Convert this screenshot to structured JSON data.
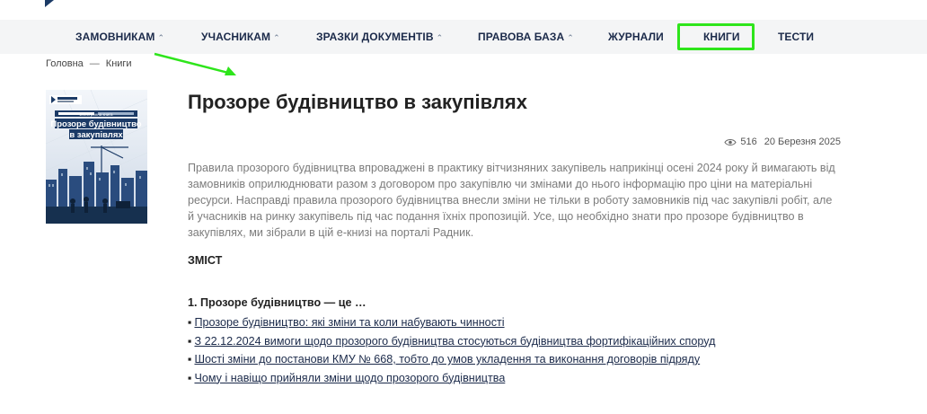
{
  "nav": {
    "items": [
      {
        "label": "ЗАМОВНИКАМ",
        "caret": "^"
      },
      {
        "label": "УЧАСНИКАМ",
        "caret": "^"
      },
      {
        "label": "ЗРАЗКИ ДОКУМЕНТІВ",
        "caret": "^"
      },
      {
        "label": "ПРАВОВА БАЗА",
        "caret": "^"
      },
      {
        "label": "ЖУРНАЛИ",
        "caret": ""
      },
      {
        "label": "КНИГИ",
        "caret": ""
      },
      {
        "label": "ТЕСТИ",
        "caret": ""
      }
    ],
    "highlight_color": "#2ee51b"
  },
  "breadcrumb": {
    "home": "Головна",
    "separator": "—",
    "current": "Книги"
  },
  "cover": {
    "brand": "РАДНИК",
    "kicker": "Електронна книга",
    "title_line1": "Прозоре будівництво",
    "title_line2": "в закупівлях"
  },
  "article": {
    "title": "Прозоре будівництво в закупівлях",
    "views": "516",
    "date": "20 Березня 2025",
    "lead": "Правила прозорого будівництва впроваджені в практику вітчизняних закупівель наприкінці осені 2024 року й вимагають від замовників оприлюднювати разом з договором про закупівлю чи змінами до нього інформацію про ціни на матеріальні ресурси. Насправді правила прозорого будівництва внесли зміни не тільки в роботу замовників під час закупівлі робіт, але й учасників на ринку закупівель під час подання їхніх пропозицій. Усе, що необхідно знати про прозоре будівництво в закупівлях, ми зібрали в цій е-книзі на порталі Радник.",
    "toc_heading": "ЗМІСТ",
    "section1_heading": "1. Прозоре будівництво — це …",
    "section1_links": [
      "Прозоре будівництво: які зміни та коли набувають чинності",
      "З 22.12.2024 вимоги щодо прозорого будівництва стосуються будівництва фортифікаційних споруд",
      "Шості зміни до постанови КМУ № 668, тобто до умов укладення та виконання договорів підряду",
      "Чому і навіщо прийняли зміни щодо прозорого будівництва"
    ],
    "bullet": "▪"
  },
  "colors": {
    "nav_bg": "#f4f5f6",
    "nav_text": "#1b2a4a",
    "lead_text": "#7c7c7c",
    "annotation": "#2ee51b"
  }
}
